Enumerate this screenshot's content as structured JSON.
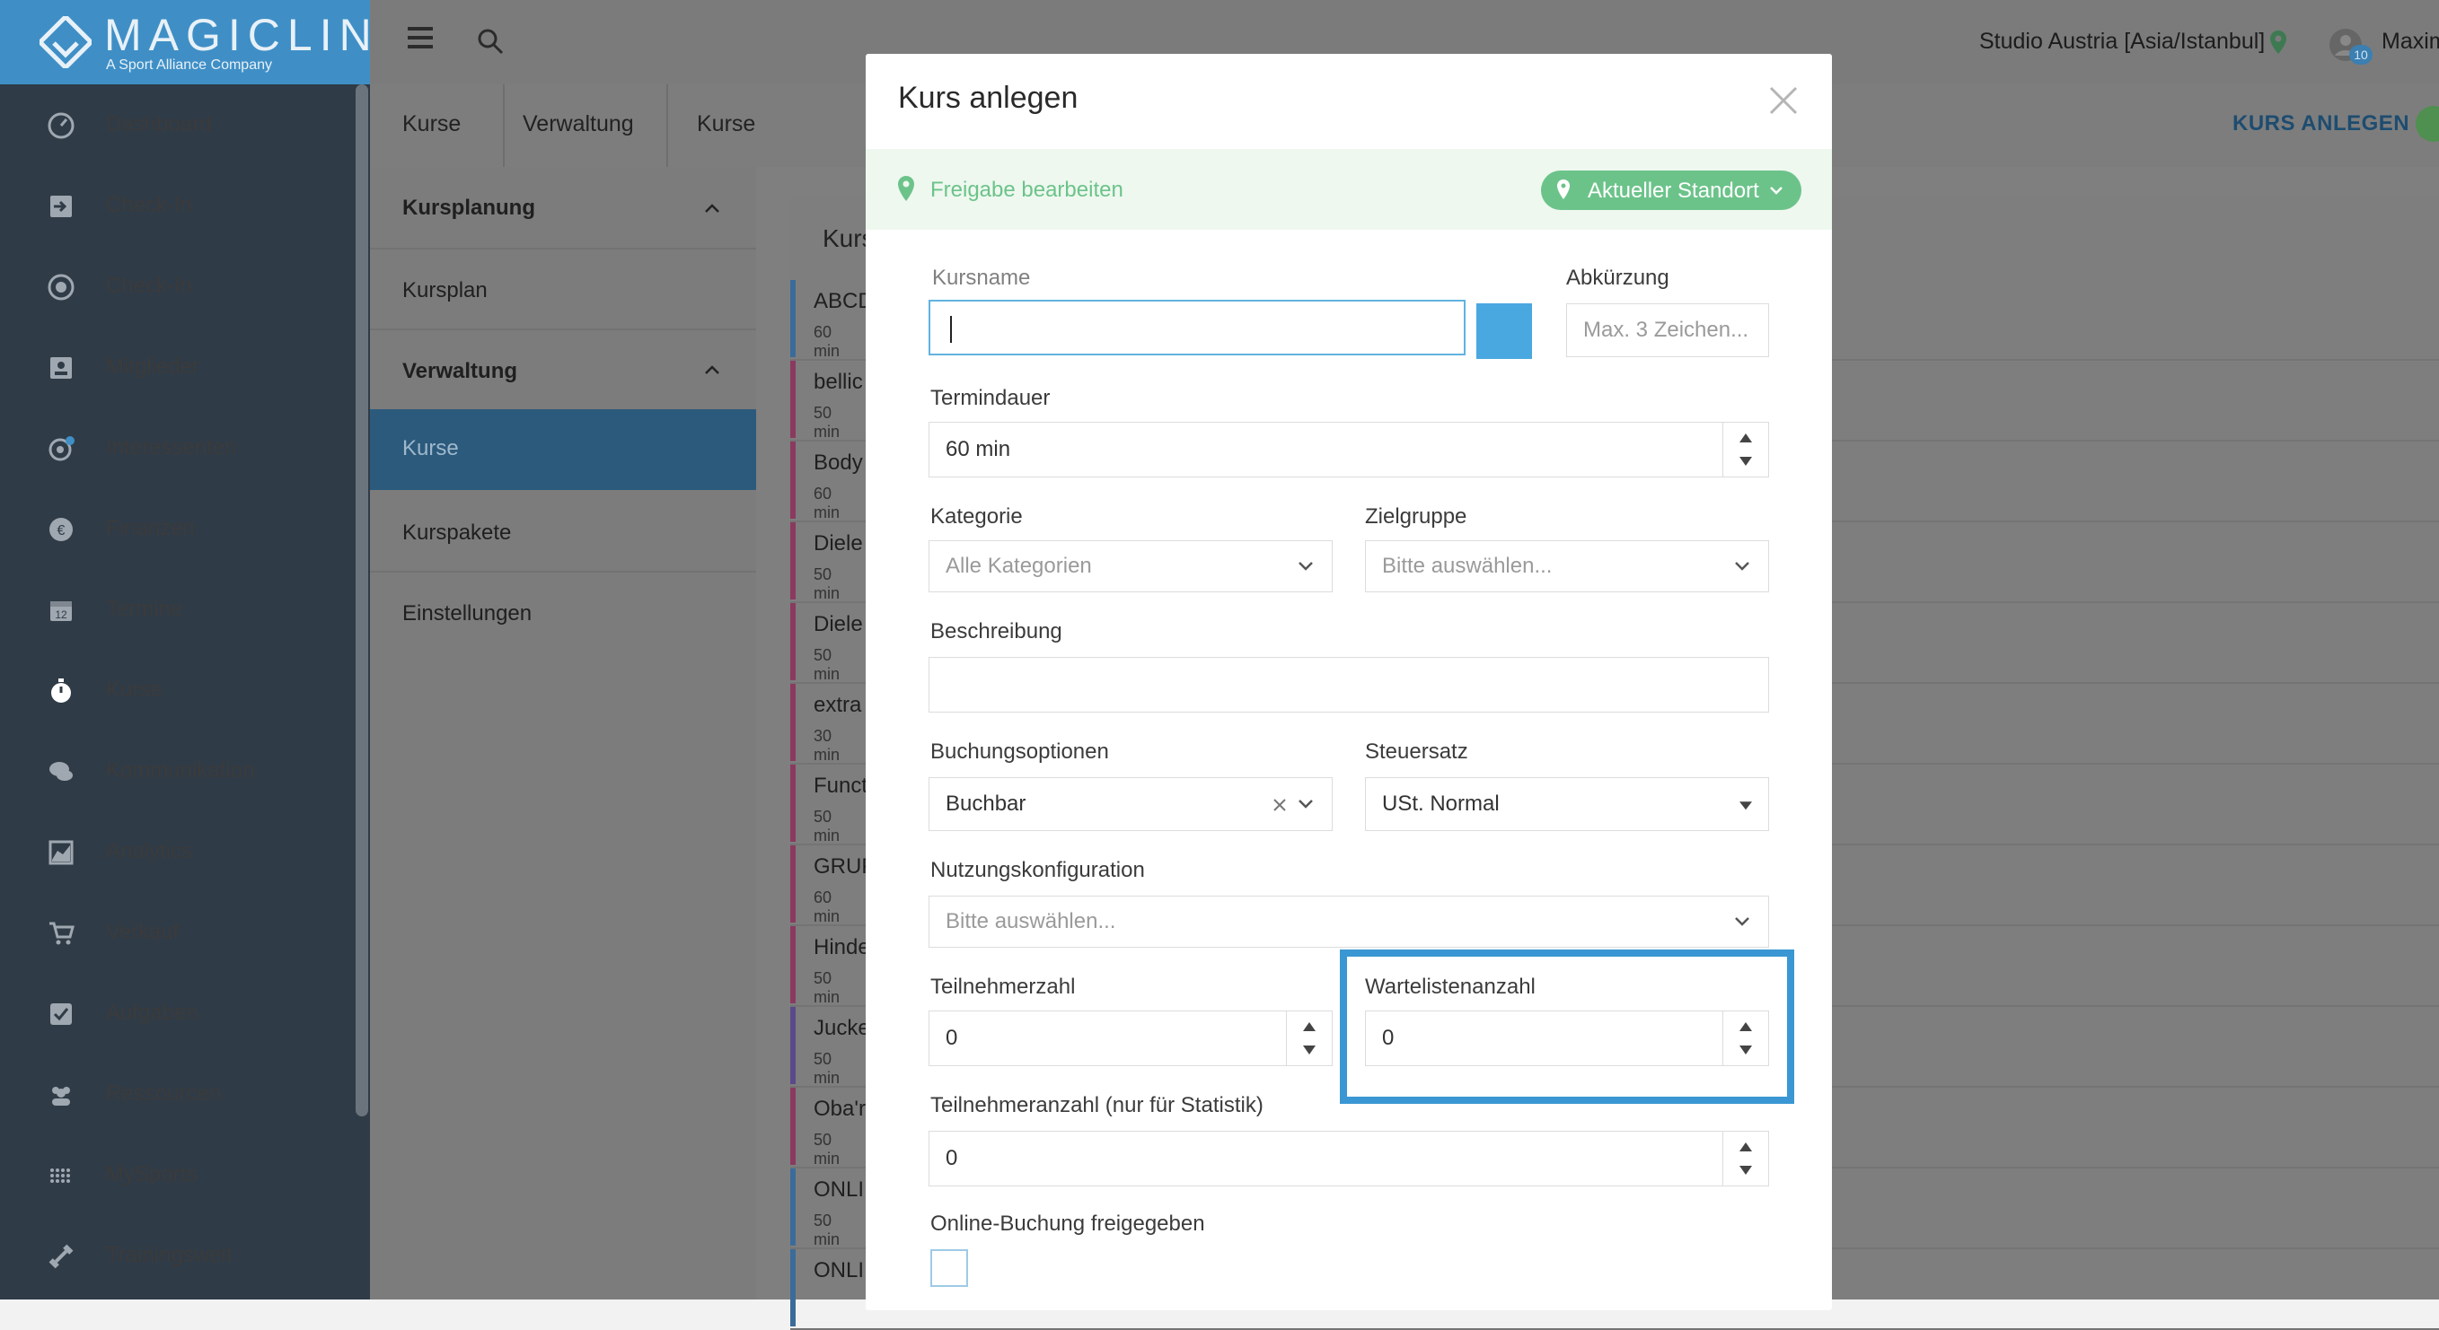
{
  "app": {
    "brand": "MAGICLINE",
    "brand_sub": "A Sport Alliance Company"
  },
  "sidebar": {
    "items": [
      {
        "label": "Dashboard",
        "icon": "dashboard-icon"
      },
      {
        "label": "Check-In",
        "icon": "checkin-arrow-icon"
      },
      {
        "label": "Check-In",
        "icon": "checkin-target-icon"
      },
      {
        "label": "Mitglieder",
        "icon": "members-icon"
      },
      {
        "label": "Interessenten",
        "icon": "leads-icon"
      },
      {
        "label": "Finanzen",
        "icon": "euro-icon"
      },
      {
        "label": "Termine",
        "icon": "calendar-icon"
      },
      {
        "label": "Kurse",
        "icon": "stopwatch-icon",
        "active": true
      },
      {
        "label": "Kommunikation",
        "icon": "chat-icon"
      },
      {
        "label": "Analytics",
        "icon": "chart-icon"
      },
      {
        "label": "Verkauf",
        "icon": "cart-icon"
      },
      {
        "label": "Aufgaben",
        "icon": "checkbox-icon"
      },
      {
        "label": "Ressourcen",
        "icon": "people-icon"
      },
      {
        "label": "MySports",
        "icon": "dots-grid-icon"
      },
      {
        "label": "Trainingswelt",
        "icon": "dumbbell-icon"
      }
    ]
  },
  "topbar": {
    "studio": "Studio Austria [Asia/Istanbul]",
    "notification_count": "10",
    "user_name": "Maxim"
  },
  "breadcrumb": [
    "Kurse",
    "Verwaltung",
    "Kurse"
  ],
  "header_action": "KURS ANLEGEN",
  "subnav": {
    "section1": "Kursplanung",
    "item1": "Kursplan",
    "section2": "Verwaltung",
    "item_active": "Kurse",
    "item3": "Kurspakete",
    "item4": "Einstellungen"
  },
  "list": {
    "title": "Kurs",
    "rows": [
      {
        "name": "ABCD",
        "dur": "60 min",
        "color": "#3a6c9a"
      },
      {
        "name": "bellic",
        "dur": "50 min",
        "color": "#8a3a5e"
      },
      {
        "name": "Body",
        "dur": "60 min",
        "color": "#8a3a5e"
      },
      {
        "name": "Diele",
        "dur": "50 min",
        "color": "#8a3a5e"
      },
      {
        "name": "Diele",
        "dur": "50 min",
        "color": "#8a3a5e"
      },
      {
        "name": "extra",
        "dur": "30 min",
        "color": "#8a3a5e"
      },
      {
        "name": "Funct",
        "dur": "50 min",
        "color": "#8a3a5e"
      },
      {
        "name": "GRUP",
        "dur": "60 min",
        "color": "#8a3a5e"
      },
      {
        "name": "Hinde",
        "dur": "50 min",
        "color": "#8a3a5e"
      },
      {
        "name": "Jucke",
        "dur": "50 min",
        "color": "#5a4a8a"
      },
      {
        "name": "Oba'r",
        "dur": "50 min",
        "color": "#8a3a5e"
      },
      {
        "name": "ONLI",
        "dur": "50 min",
        "color": "#3a6c9a"
      },
      {
        "name": "ONLI",
        "dur": "",
        "color": "#3a6c9a"
      }
    ]
  },
  "modal": {
    "title": "Kurs anlegen",
    "release_text": "Freigabe bearbeiten",
    "location_button": "Aktueller Standort",
    "fields": {
      "kursname": {
        "label": "Kursname",
        "value": ""
      },
      "abkuerzung": {
        "label": "Abkürzung",
        "placeholder": "Max. 3 Zeichen..."
      },
      "termindauer": {
        "label": "Termindauer",
        "value": "60 min"
      },
      "kategorie": {
        "label": "Kategorie",
        "placeholder": "Alle Kategorien"
      },
      "zielgruppe": {
        "label": "Zielgruppe",
        "placeholder": "Bitte auswählen..."
      },
      "beschreibung": {
        "label": "Beschreibung",
        "value": ""
      },
      "buchungsoptionen": {
        "label": "Buchungsoptionen",
        "value": "Buchbar"
      },
      "steuersatz": {
        "label": "Steuersatz",
        "value": "USt. Normal"
      },
      "nutzungskonfiguration": {
        "label": "Nutzungskonfiguration",
        "placeholder": "Bitte auswählen..."
      },
      "teilnehmerzahl": {
        "label": "Teilnehmerzahl",
        "value": "0"
      },
      "wartelistenanzahl": {
        "label": "Wartelistenanzahl",
        "value": "0"
      },
      "teilnehmer_statistik": {
        "label": "Teilnehmeranzahl (nur für Statistik)",
        "value": "0"
      },
      "online_buchung": {
        "label": "Online-Buchung freigegeben",
        "checked": false
      }
    },
    "kursname_color": "#4aa8e0"
  }
}
